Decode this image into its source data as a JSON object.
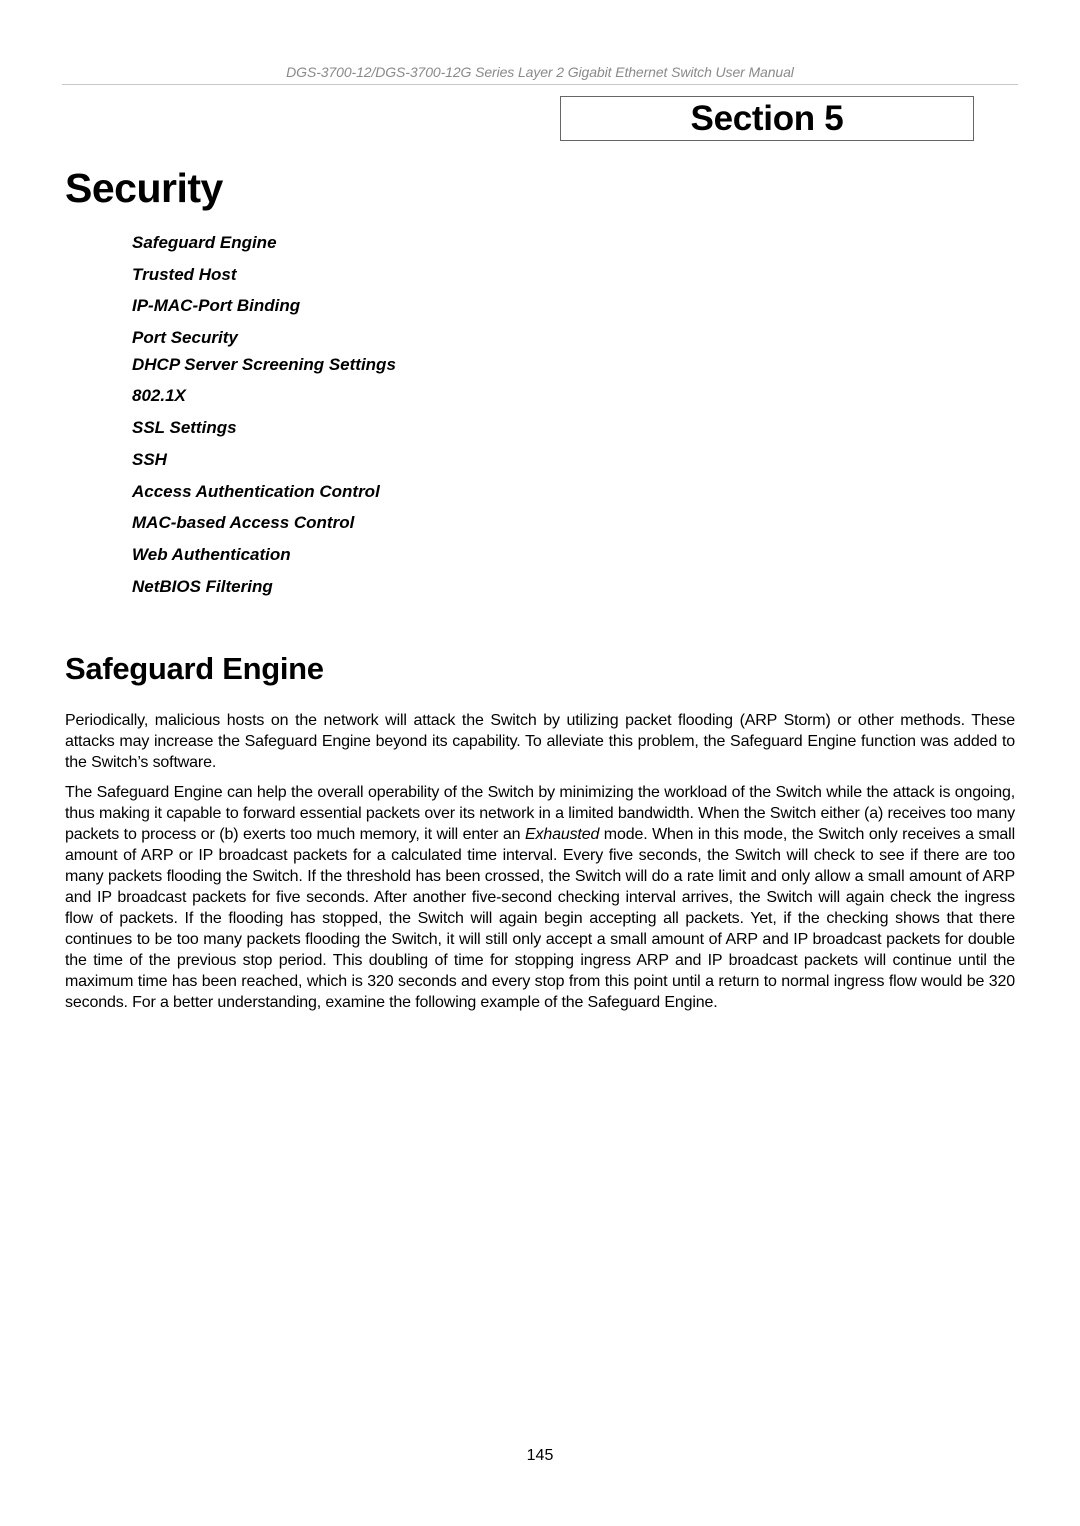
{
  "header": {
    "running_title": "DGS-3700-12/DGS-3700-12G Series Layer 2 Gigabit Ethernet Switch User Manual",
    "section_label": "Section 5"
  },
  "page": {
    "title": "Security",
    "toc": [
      "Safeguard Engine",
      "Trusted Host",
      "IP-MAC-Port Binding",
      "Port Security",
      "DHCP Server Screening Settings",
      "802.1X",
      "SSL Settings",
      "SSH",
      "Access Authentication Control",
      "MAC-based Access Control",
      "Web Authentication",
      "NetBIOS Filtering"
    ],
    "section_heading": "Safeguard Engine",
    "paragraph_1": "Periodically, malicious hosts on the network will attack the Switch by utilizing packet flooding (ARP Storm) or other methods. These attacks may increase the Safeguard Engine beyond its capability. To alleviate this problem, the Safeguard Engine function was added to the Switch’s software.",
    "paragraph_2": {
      "before_italic": "The Safeguard Engine can help the overall operability of the Switch by minimizing the workload of the Switch while the attack is ongoing, thus making it capable to forward essential packets over its network in a limited bandwidth. When the Switch either (a) receives too many packets to process or (b) exerts too much memory, it will enter an ",
      "italic": "Exhausted",
      "after_italic": " mode. When in this mode, the Switch only receives a small amount of ARP or IP broadcast packets for a calculated time interval. Every five seconds, the Switch will check to see if there are too many packets flooding the Switch. If the threshold has been crossed, the Switch will do a rate limit and only allow a small amount of ARP and IP broadcast packets for five seconds. After another five-second checking interval arrives, the Switch will again check the ingress flow of packets. If the flooding has stopped, the Switch will again begin accepting all packets. Yet, if the checking shows that there continues to be too many packets flooding the Switch, it will still only accept a small amount of ARP and IP broadcast packets for double the time of the previous stop period. This doubling of time for stopping ingress ARP and IP broadcast packets will continue until the maximum time has been reached, which is 320 seconds and every stop from this point until a return to normal ingress flow would be 320 seconds. For a better understanding, examine the following example of the Safeguard Engine."
    },
    "page_number": "145"
  }
}
